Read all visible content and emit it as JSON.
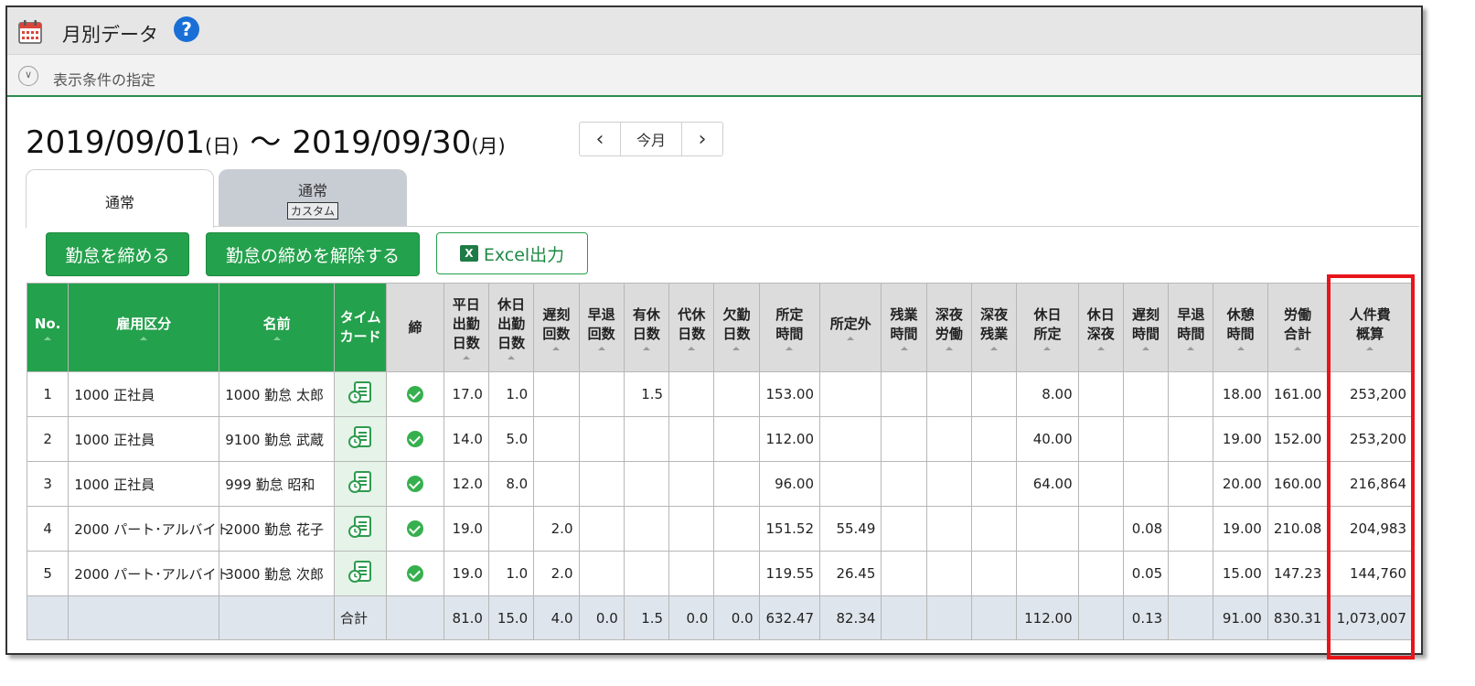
{
  "app": {
    "title": "月別データ",
    "help_label": "?"
  },
  "filter": {
    "label": "表示条件の指定"
  },
  "period": {
    "start": "2019/09/01",
    "start_dow": "(日)",
    "separator": "～",
    "end": "2019/09/30",
    "end_dow": "(月)"
  },
  "month_nav": {
    "prev": "‹",
    "current": "今月",
    "next": "›"
  },
  "tabs": [
    {
      "label": "通常"
    },
    {
      "label": "通常",
      "sub_label": "カスタム"
    }
  ],
  "actions": {
    "close": "勤怠を締める",
    "unclose": "勤怠の締めを解除する",
    "excel": "Excel出力",
    "excel_icon_letter": "X"
  },
  "table": {
    "headers": [
      "No.",
      "雇用区分",
      "名前",
      "タイム\nカード",
      "締",
      "平日\n出勤\n日数",
      "休日\n出勤\n日数",
      "遅刻\n回数",
      "早退\n回数",
      "有休\n日数",
      "代休\n日数",
      "欠勤\n日数",
      "所定\n時間",
      "所定外",
      "残業\n時間",
      "深夜\n労働",
      "深夜\n残業",
      "休日\n所定",
      "休日\n深夜",
      "遅刻\n時間",
      "早退\n時間",
      "休憩\n時間",
      "労働\n合計",
      "人件費\n概算"
    ],
    "rows": [
      [
        "1",
        "1000 正社員",
        "1000 勤怠 太郎",
        "",
        "",
        "17.0",
        "1.0",
        "",
        "",
        "1.5",
        "",
        "",
        "153.00",
        "",
        "",
        "",
        "",
        "8.00",
        "",
        "",
        "",
        "18.00",
        "161.00",
        "253,200"
      ],
      [
        "2",
        "1000 正社員",
        "9100 勤怠 武蔵",
        "",
        "",
        "14.0",
        "5.0",
        "",
        "",
        "",
        "",
        "",
        "112.00",
        "",
        "",
        "",
        "",
        "40.00",
        "",
        "",
        "",
        "19.00",
        "152.00",
        "253,200"
      ],
      [
        "3",
        "1000 正社員",
        "999 勤怠 昭和",
        "",
        "",
        "12.0",
        "8.0",
        "",
        "",
        "",
        "",
        "",
        "96.00",
        "",
        "",
        "",
        "",
        "64.00",
        "",
        "",
        "",
        "20.00",
        "160.00",
        "216,864"
      ],
      [
        "4",
        "2000 パート･アルバイト",
        "2000 勤怠 花子",
        "",
        "",
        "19.0",
        "",
        "2.0",
        "",
        "",
        "",
        "",
        "151.52",
        "55.49",
        "",
        "",
        "",
        "",
        "",
        "0.08",
        "",
        "19.00",
        "210.08",
        "204,983"
      ],
      [
        "5",
        "2000 パート･アルバイト",
        "3000 勤怠 次郎",
        "",
        "",
        "19.0",
        "1.0",
        "2.0",
        "",
        "",
        "",
        "",
        "119.55",
        "26.45",
        "",
        "",
        "",
        "",
        "",
        "0.05",
        "",
        "15.00",
        "147.23",
        "144,760"
      ]
    ],
    "total": [
      "",
      "",
      "",
      "合計",
      "",
      "81.0",
      "15.0",
      "4.0",
      "0.0",
      "1.5",
      "0.0",
      "0.0",
      "632.47",
      "82.34",
      "",
      "",
      "",
      "112.00",
      "",
      "0.13",
      "",
      "91.00",
      "830.31",
      "1,073,007"
    ]
  }
}
